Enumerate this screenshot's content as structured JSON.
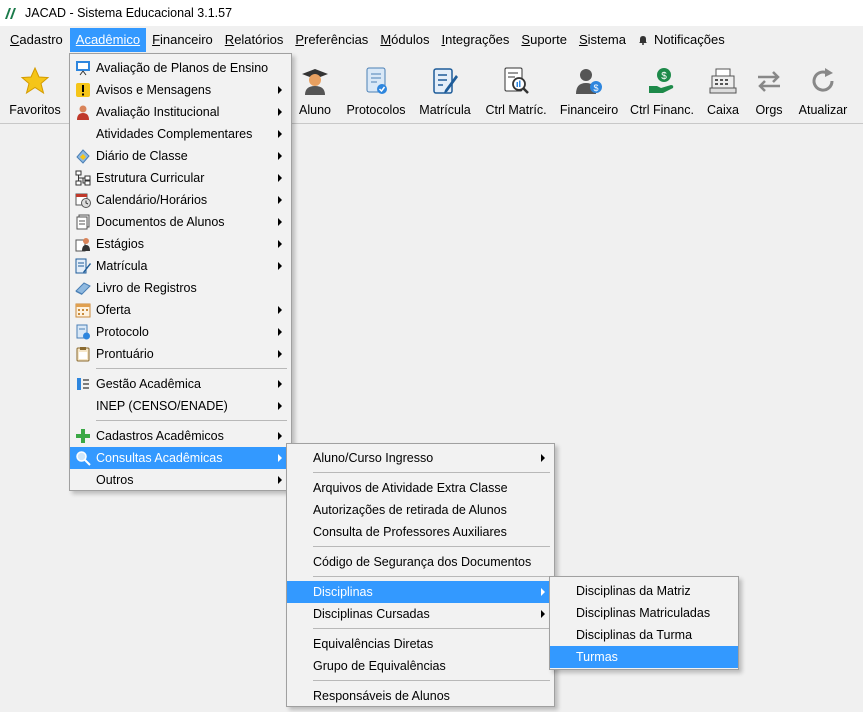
{
  "window": {
    "title": "JACAD - Sistema Educacional 3.1.57"
  },
  "menubar": {
    "items": [
      {
        "label": "Cadastro",
        "ul": "C",
        "rest": "adastro"
      },
      {
        "label": "Acadêmico",
        "ul": "A",
        "rest": "cadêmico"
      },
      {
        "label": "Financeiro",
        "ul": "F",
        "rest": "inanceiro"
      },
      {
        "label": "Relatórios",
        "ul": "R",
        "rest": "elatórios"
      },
      {
        "label": "Preferências",
        "ul": "P",
        "rest": "referências"
      },
      {
        "label": "Módulos",
        "ul": "M",
        "rest": "ódulos"
      },
      {
        "label": "Integrações",
        "ul": "I",
        "rest": "ntegrações"
      },
      {
        "label": "Suporte",
        "ul": "S",
        "rest": "uporte"
      },
      {
        "label": "Sistema",
        "ul": "S",
        "rest": "istema"
      }
    ],
    "notifications": "Notificações"
  },
  "toolbar": {
    "favoritos": "Favoritos",
    "aluno": "Aluno",
    "protocolos": "Protocolos",
    "matricula": "Matrícula",
    "ctrl_matric": "Ctrl Matríc.",
    "financeiro": "Financeiro",
    "ctrl_financ": "Ctrl Financ.",
    "caixa": "Caixa",
    "orgs": "Orgs",
    "atualizar": "Atualizar"
  },
  "academico_menu": {
    "items": [
      {
        "label": "Avaliação de Planos de Ensino",
        "icon": "presentation-icon"
      },
      {
        "label": "Avisos e Mensagens",
        "icon": "warning-icon",
        "submenu": true
      },
      {
        "label": "Avaliação Institucional",
        "icon": "user-icon",
        "submenu": true
      },
      {
        "label": "Atividades Complementares",
        "icon": "",
        "submenu": true
      },
      {
        "label": "Diário de Classe",
        "icon": "book-icon",
        "submenu": true
      },
      {
        "label": "Estrutura Curricular",
        "icon": "hierarchy-icon",
        "submenu": true
      },
      {
        "label": "Calendário/Horários",
        "icon": "calendar-clock-icon",
        "submenu": true
      },
      {
        "label": "Documentos de Alunos",
        "icon": "documents-icon",
        "submenu": true
      },
      {
        "label": "Estágios",
        "icon": "internship-icon",
        "submenu": true
      },
      {
        "label": "Matrícula",
        "icon": "form-pencil-icon",
        "submenu": true
      },
      {
        "label": "Livro de Registros",
        "icon": "notebook-icon"
      },
      {
        "label": "Oferta",
        "icon": "calendar-icon",
        "submenu": true
      },
      {
        "label": "Protocolo",
        "icon": "protocol-icon",
        "submenu": true
      },
      {
        "label": "Prontuário",
        "icon": "clipboard-icon",
        "submenu": true
      },
      {
        "label": "Gestão Acadêmica",
        "icon": "management-icon",
        "submenu": true
      },
      {
        "label": "INEP (CENSO/ENADE)",
        "icon": "",
        "submenu": true
      },
      {
        "label": "Cadastros Acadêmicos",
        "icon": "plus-icon",
        "submenu": true
      },
      {
        "label": "Consultas Acadêmicas",
        "icon": "search-icon",
        "submenu": true
      },
      {
        "label": "Outros",
        "icon": "",
        "submenu": true
      }
    ]
  },
  "consultas_menu": {
    "items": [
      {
        "label": "Aluno/Curso Ingresso",
        "submenu": true
      },
      {
        "label": "Arquivos de Atividade Extra Classe"
      },
      {
        "label": "Autorizações de retirada de Alunos"
      },
      {
        "label": "Consulta de Professores Auxiliares"
      },
      {
        "label": "Código de Segurança dos Documentos"
      },
      {
        "label": "Disciplinas",
        "submenu": true
      },
      {
        "label": "Disciplinas Cursadas",
        "submenu": true
      },
      {
        "label": "Equivalências Diretas"
      },
      {
        "label": "Grupo de Equivalências"
      },
      {
        "label": "Responsáveis de Alunos"
      }
    ]
  },
  "disciplinas_menu": {
    "items": [
      {
        "label": "Disciplinas da Matriz"
      },
      {
        "label": "Disciplinas Matriculadas"
      },
      {
        "label": "Disciplinas da Turma"
      },
      {
        "label": "Turmas"
      }
    ]
  },
  "colors": {
    "highlight": "#3399ff",
    "menu_bg": "#f2f2f2",
    "window_bg": "#f0f0f0"
  }
}
